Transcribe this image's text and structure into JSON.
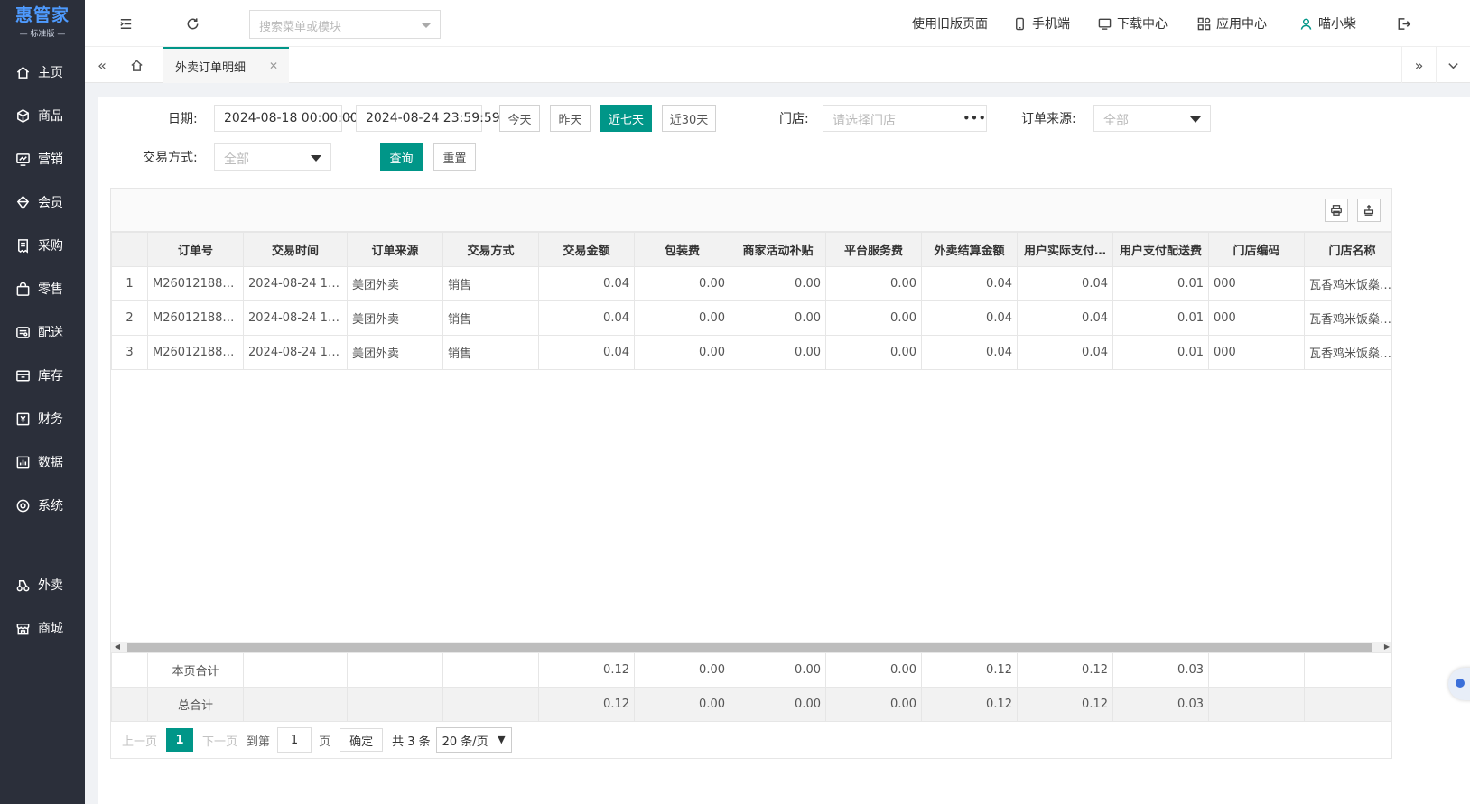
{
  "sidebar": {
    "logo_main": "惠管家",
    "logo_sub": "标准版",
    "items": [
      {
        "label": "主页",
        "icon": "home-icon"
      },
      {
        "label": "商品",
        "icon": "cube-icon"
      },
      {
        "label": "营销",
        "icon": "chart-icon"
      },
      {
        "label": "会员",
        "icon": "diamond-icon"
      },
      {
        "label": "采购",
        "icon": "receipt-icon"
      },
      {
        "label": "零售",
        "icon": "bag-icon"
      },
      {
        "label": "配送",
        "icon": "truck-icon"
      },
      {
        "label": "库存",
        "icon": "box-icon"
      },
      {
        "label": "财务",
        "icon": "yen-icon"
      },
      {
        "label": "数据",
        "icon": "bar-chart-icon"
      },
      {
        "label": "系统",
        "icon": "settings-icon"
      },
      {
        "label": "外卖",
        "icon": "delivery-icon"
      },
      {
        "label": "商城",
        "icon": "store-icon"
      }
    ]
  },
  "topbar": {
    "search_placeholder": "搜索菜单或模块",
    "old_page": "使用旧版页面",
    "mobile": "手机端",
    "download": "下载中心",
    "apps": "应用中心",
    "user": "喵小柴"
  },
  "tabs": {
    "active": "外卖订单明细"
  },
  "filters": {
    "date_label": "日期:",
    "date_start": "2024-08-18 00:00:00",
    "date_sep": "-",
    "date_end": "2024-08-24 23:59:59",
    "quick": [
      "今天",
      "昨天",
      "近七天",
      "近30天"
    ],
    "quick_active": "近七天",
    "store_label": "门店:",
    "store_placeholder": "请选择门店",
    "source_label": "订单来源:",
    "source_value": "全部",
    "trade_label": "交易方式:",
    "trade_value": "全部",
    "query": "查询",
    "reset": "重置"
  },
  "table": {
    "columns": [
      "",
      "订单号",
      "交易时间",
      "订单来源",
      "交易方式",
      "交易金额",
      "包装费",
      "商家活动补贴",
      "平台服务费",
      "外卖结算金额",
      "用户实际支付…",
      "用户支付配送费",
      "门店编码",
      "门店名称"
    ],
    "rows": [
      [
        "1",
        "M260121889…",
        "2024-08-24 10…",
        "美团外卖",
        "销售",
        "0.04",
        "0.00",
        "0.00",
        "0.00",
        "0.04",
        "0.04",
        "0.01",
        "000",
        "瓦香鸡米饭燊…"
      ],
      [
        "2",
        "M260121889…",
        "2024-08-24 10…",
        "美团外卖",
        "销售",
        "0.04",
        "0.00",
        "0.00",
        "0.00",
        "0.04",
        "0.04",
        "0.01",
        "000",
        "瓦香鸡米饭燊…"
      ],
      [
        "3",
        "M260121889…",
        "2024-08-24 10…",
        "美团外卖",
        "销售",
        "0.04",
        "0.00",
        "0.00",
        "0.00",
        "0.04",
        "0.04",
        "0.01",
        "000",
        "瓦香鸡米饭燊…"
      ]
    ],
    "page_total": [
      "",
      "本页合计",
      "",
      "",
      "",
      "0.12",
      "0.00",
      "0.00",
      "0.00",
      "0.12",
      "0.12",
      "0.03",
      "",
      ""
    ],
    "grand_total": [
      "",
      "总合计",
      "",
      "",
      "",
      "0.12",
      "0.00",
      "0.00",
      "0.00",
      "0.12",
      "0.12",
      "0.03",
      "",
      ""
    ]
  },
  "pager": {
    "prev": "上一页",
    "current": "1",
    "next": "下一页",
    "goto": "到第",
    "page_input": "1",
    "page_unit": "页",
    "confirm": "确定",
    "total": "共 3 条",
    "per_page": "20 条/页"
  },
  "colors": {
    "accent": "#009688",
    "sidebar_bg": "#2b2f3a"
  }
}
